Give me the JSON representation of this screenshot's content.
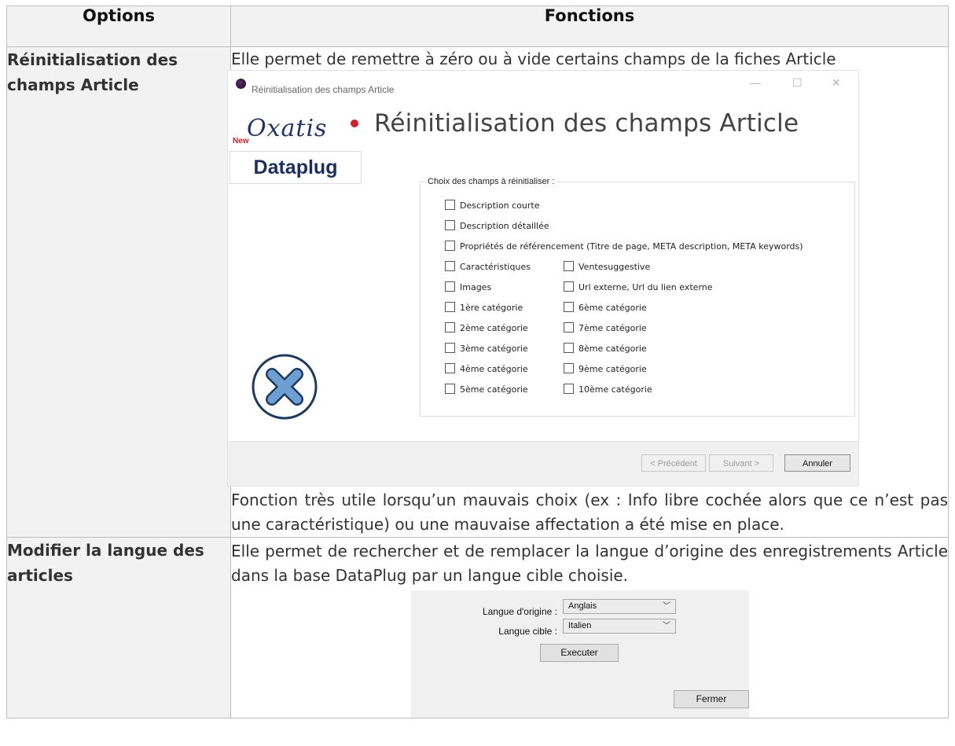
{
  "table": {
    "col_options": "Options",
    "col_fonctions": "Fonctions"
  },
  "row1": {
    "option_label": "Réinitialisation des champs Article",
    "intro": "Elle permet de remettre à zéro ou à vide certains champs de la fiches Article",
    "note": "Fonction très utile lorsqu’un mauvais choix (ex : Info libre cochée alors que ce n’est pas une caractéristique) ou une mauvaise affectation a été mise en place.",
    "dialog": {
      "window_title": "Réinitialisation des champs Article",
      "heading": "Réinitialisation des champs Article",
      "logo_new": "New",
      "logo_brand": "Oxatis",
      "logo_product": "Dataplug",
      "group_legend": "Choix des champs à réinitialiser :",
      "checkboxes_full": [
        "Description courte",
        "Description détaillée",
        "Propriétés de référencement (Titre de page, META description, META keywords)"
      ],
      "checkboxes_left": [
        "Caractéristiques",
        "Images",
        "1ère catégorie",
        "2ème catégorie",
        "3ème catégorie",
        "4ème catégorie",
        "5ème catégorie"
      ],
      "checkboxes_right": [
        "Ventesuggestive",
        "Url externe, Url du lien externe",
        "6ème catégorie",
        "7ème catégorie",
        "8ème catégorie",
        "9ème catégorie",
        "10ème catégorie"
      ],
      "btn_prev": "< Précédent",
      "btn_next": "Suivant >",
      "btn_cancel": "Annuler"
    }
  },
  "row2": {
    "option_label": "Modifier la langue des articles",
    "intro": "Elle permet de rechercher et de remplacer la langue d’origine des enregistrements Article dans la base DataPlug par un langue cible choisie.",
    "dialog": {
      "source_label": "Langue d'origine :",
      "source_value": "Anglais",
      "target_label": "Langue cible :",
      "target_value": "Italien",
      "btn_execute": "Executer",
      "btn_close": "Fermer"
    }
  }
}
